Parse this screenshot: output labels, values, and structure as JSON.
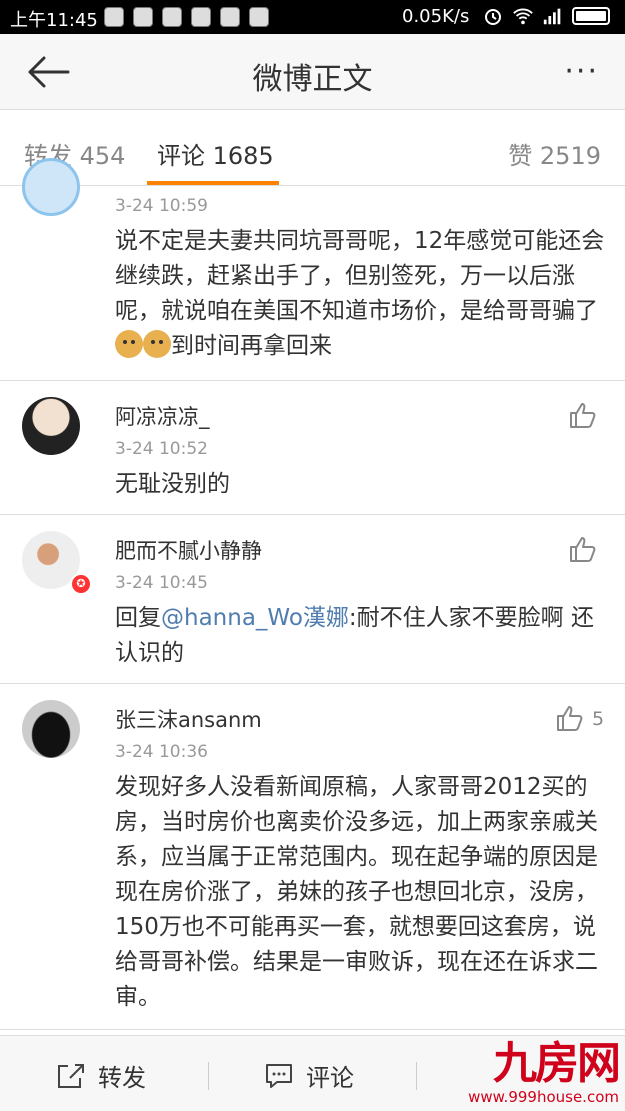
{
  "status_bar": {
    "time": "上午11:45",
    "network_speed": "0.05K/s",
    "icons": [
      "alarm-icon",
      "wifi-icon",
      "signal-icon",
      "battery-icon"
    ]
  },
  "header": {
    "title": "微博正文",
    "back_icon": "back-arrow-icon",
    "more_label": "···"
  },
  "tabs": [
    {
      "label": "转发 454"
    },
    {
      "label": "评论 1685",
      "active": true
    },
    {
      "label": "赞 2519"
    }
  ],
  "comments": [
    {
      "timestamp": "3-24 10:59",
      "text_before": "说不定是夫妻共同坑哥哥呢，12年感觉可能还会继续跌，赶紧出手了，但别签死，万一以后涨呢，就说咱在美国不知道市场价，是给哥哥骗了",
      "text_after": "到时间再拿回来"
    },
    {
      "name": "阿凉凉凉_",
      "timestamp": "3-24 10:52",
      "text": "无耻没别的"
    },
    {
      "name": "肥而不腻小静静",
      "timestamp": "3-24 10:45",
      "reply_prefix": "回复",
      "mention": "@hanna_Wo漢娜",
      "text": ":耐不住人家不要脸啊 还认识的"
    },
    {
      "name": "张三沫ansanm",
      "timestamp": "3-24 10:36",
      "likes": "5",
      "text": "发现好多人没看新闻原稿，人家哥哥2012买的房，当时房价也离卖价没多远，加上两家亲戚关系，应当属于正常范围内。现在起争端的原因是现在房价涨了，弟妹的孩子也想回北京，没房，150万也不可能再买一套，就想要回这套房，说给哥哥补偿。结果是一审败诉，现在还在诉求二审。"
    }
  ],
  "bottom_bar": {
    "forward_label": "转发",
    "comment_label": "评论"
  },
  "watermark": {
    "logo": "九房网",
    "url": "www.999house.com"
  },
  "colors": {
    "accent": "#ff8200",
    "mention": "#507daf",
    "watermark": "#d0021b"
  }
}
